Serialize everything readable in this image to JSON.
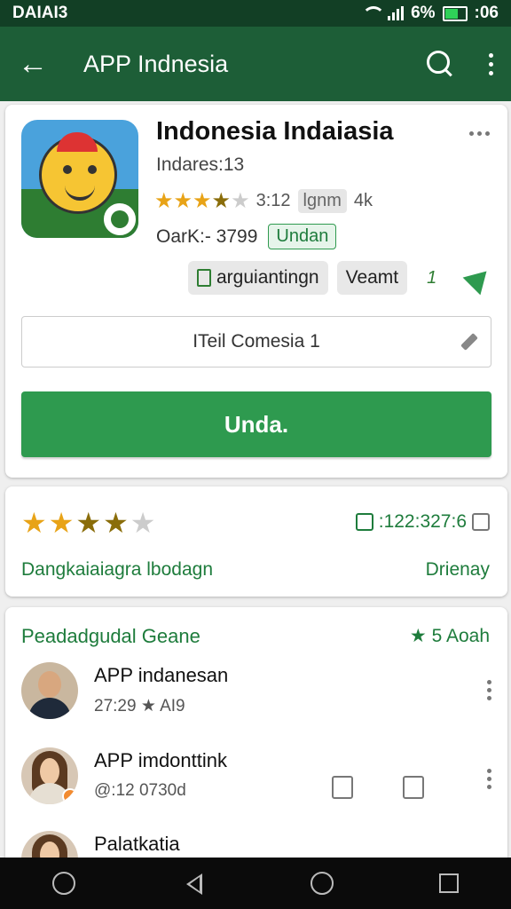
{
  "status_bar": {
    "left_text": "DAIAI3",
    "battery_text": "6%",
    "time": ":06"
  },
  "app_bar": {
    "title": "APP Indnesia"
  },
  "app": {
    "name": "Indonesia Indaiasia",
    "developer": "Indares:13",
    "stars": 3.5,
    "rating_value": "3:12",
    "rating_size": "lgnm",
    "downloads": "4k",
    "meta_label": "OarK:- 3799",
    "meta_badge": "Undan",
    "chip1": "arguiantingn",
    "chip2": "Veamt",
    "chip_count": "1",
    "field_text": "ITeil Comesia 1",
    "install_label": "Unda."
  },
  "rating_card": {
    "stars": 4,
    "count": ":122:327:6",
    "left_text": "Dangkaiaiagra lbodagn",
    "right_text": "Drienay"
  },
  "reviews": {
    "section_title": "Peadadgudal Geane",
    "section_link": "5 Aoah",
    "items": [
      {
        "name": "APP indanesan",
        "sub": "27:29 ★ AI9"
      },
      {
        "name": "APP imdonttink",
        "sub": "@:12 0730d"
      },
      {
        "name": "Palatkatia",
        "sub": ""
      }
    ]
  },
  "colors": {
    "primary_dark": "#1d5e37",
    "accent_green": "#2e9a4f",
    "star": "#e8a317"
  },
  "icons": [
    "wifi-icon",
    "signal-icon",
    "battery-icon",
    "back-arrow-icon",
    "search-icon",
    "more-vert-icon",
    "share-icon",
    "pin-icon",
    "thumbs-up-icon",
    "nav-back-icon",
    "nav-home-icon",
    "nav-recent-icon"
  ]
}
